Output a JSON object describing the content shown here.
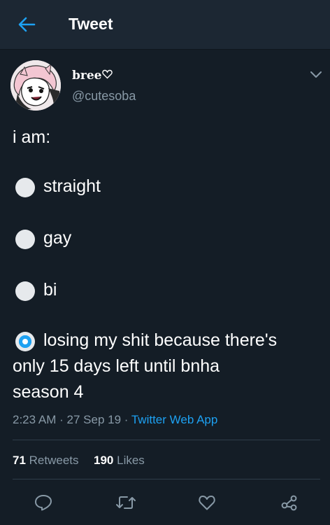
{
  "header": {
    "title": "Tweet",
    "back_icon": "arrow-left-icon",
    "accent": "#1da1f2"
  },
  "author": {
    "name": "bree",
    "name_suffix_icon": "heart-outline-icon",
    "handle": "@cutesoba"
  },
  "tweet": {
    "intro": "i am:",
    "options": [
      {
        "label": "straight",
        "selected": false
      },
      {
        "label": "gay",
        "selected": false
      },
      {
        "label": "bi",
        "selected": false
      },
      {
        "label_lines": [
          "losing my shit because there's",
          "only 15 days left until bnha",
          "season 4"
        ],
        "selected": true
      }
    ]
  },
  "meta": {
    "time": "2:23 AM",
    "sep1": "·",
    "date": "27 Sep 19",
    "sep2": "·",
    "source": "Twitter Web App"
  },
  "stats": {
    "retweets_count": "71",
    "retweets_label": "Retweets",
    "likes_count": "190",
    "likes_label": "Likes"
  },
  "actions": [
    "reply-icon",
    "retweet-icon",
    "like-icon",
    "share-icon"
  ],
  "colors": {
    "background": "#141d26",
    "header_bg": "#1c2733",
    "muted_text": "#8899a6",
    "link": "#1da1f2"
  }
}
